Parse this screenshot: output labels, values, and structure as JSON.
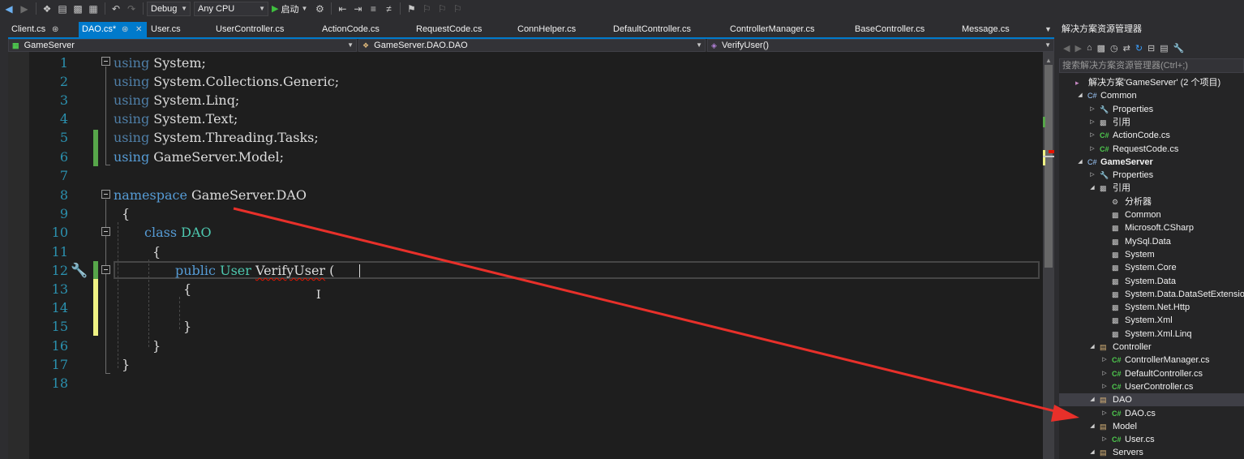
{
  "toolbar": {
    "config_combo": "Debug",
    "platform_combo": "Any CPU",
    "start_label": "启动"
  },
  "tabs": [
    {
      "label": "Client.cs",
      "active": false
    },
    {
      "label": "DAO.cs*",
      "active": true
    },
    {
      "label": "User.cs",
      "active": false
    },
    {
      "label": "UserController.cs",
      "active": false
    },
    {
      "label": "ActionCode.cs",
      "active": false
    },
    {
      "label": "RequestCode.cs",
      "active": false
    },
    {
      "label": "ConnHelper.cs",
      "active": false
    },
    {
      "label": "DefaultController.cs",
      "active": false
    },
    {
      "label": "ControllerManager.cs",
      "active": false
    },
    {
      "label": "BaseController.cs",
      "active": false
    },
    {
      "label": "Message.cs",
      "active": false
    }
  ],
  "navbar": {
    "project": "GameServer",
    "type": "GameServer.DAO.DAO",
    "member": "VerifyUser()"
  },
  "editor": {
    "line_numbers": [
      "1",
      "2",
      "3",
      "4",
      "5",
      "6",
      "7",
      "8",
      "9",
      "10",
      "11",
      "12",
      "13",
      "14",
      "15",
      "16",
      "17",
      "18"
    ],
    "lines": {
      "l1_kw": "using",
      "l1_rest": " System;",
      "l2_kw": "using",
      "l2_rest": " System.Collections.Generic;",
      "l3_kw": "using",
      "l3_rest": " System.Linq;",
      "l4_kw": "using",
      "l4_rest": " System.Text;",
      "l5_kw": "using",
      "l5_rest": " System.Threading.Tasks;",
      "l6_kw": "using",
      "l6_rest": " GameServer.Model;",
      "l8_kw": "namespace",
      "l8_rest": " GameServer.DAO",
      "l9": "{",
      "l10_kw": "class",
      "l10_type": "DAO",
      "l11": "{",
      "l12_kw": "public",
      "l12_type": "User",
      "l12_name": "VerifyUser",
      "l12_paren": " (",
      "l13": "{",
      "l15": "}",
      "l16": "}",
      "l17": "}"
    }
  },
  "solution_explorer": {
    "title": "解决方案资源管理器",
    "search_placeholder": "搜索解决方案资源管理器(Ctrl+;)",
    "tree": [
      {
        "label": "解决方案'GameServer' (2 个项目)",
        "icon": "solution-icon",
        "depth": 0,
        "expander": ""
      },
      {
        "label": "Common",
        "icon": "csproj-icon",
        "depth": 1,
        "expander": "expanded"
      },
      {
        "label": "Properties",
        "icon": "wrench-icon",
        "depth": 2,
        "expander": "collapsed"
      },
      {
        "label": "引用",
        "icon": "references-icon",
        "depth": 2,
        "expander": "collapsed"
      },
      {
        "label": "ActionCode.cs",
        "icon": "csharp-file-icon",
        "depth": 2,
        "expander": "collapsed"
      },
      {
        "label": "RequestCode.cs",
        "icon": "csharp-file-icon",
        "depth": 2,
        "expander": "collapsed"
      },
      {
        "label": "GameServer",
        "icon": "csproj-icon",
        "depth": 1,
        "expander": "expanded",
        "bold": true
      },
      {
        "label": "Properties",
        "icon": "wrench-icon",
        "depth": 2,
        "expander": "collapsed"
      },
      {
        "label": "引用",
        "icon": "references-icon",
        "depth": 2,
        "expander": "expanded"
      },
      {
        "label": "分析器",
        "icon": "analyzer-icon",
        "depth": 3,
        "expander": ""
      },
      {
        "label": "Common",
        "icon": "reference-icon",
        "depth": 3,
        "expander": ""
      },
      {
        "label": "Microsoft.CSharp",
        "icon": "reference-icon",
        "depth": 3,
        "expander": ""
      },
      {
        "label": "MySql.Data",
        "icon": "reference-icon",
        "depth": 3,
        "expander": ""
      },
      {
        "label": "System",
        "icon": "reference-icon",
        "depth": 3,
        "expander": ""
      },
      {
        "label": "System.Core",
        "icon": "reference-icon",
        "depth": 3,
        "expander": ""
      },
      {
        "label": "System.Data",
        "icon": "reference-icon",
        "depth": 3,
        "expander": ""
      },
      {
        "label": "System.Data.DataSetExtensions",
        "icon": "reference-icon",
        "depth": 3,
        "expander": ""
      },
      {
        "label": "System.Net.Http",
        "icon": "reference-icon",
        "depth": 3,
        "expander": ""
      },
      {
        "label": "System.Xml",
        "icon": "reference-icon",
        "depth": 3,
        "expander": ""
      },
      {
        "label": "System.Xml.Linq",
        "icon": "reference-icon",
        "depth": 3,
        "expander": ""
      },
      {
        "label": "Controller",
        "icon": "folder-icon",
        "depth": 2,
        "expander": "expanded"
      },
      {
        "label": "ControllerManager.cs",
        "icon": "csharp-file-icon",
        "depth": 3,
        "expander": "collapsed"
      },
      {
        "label": "DefaultController.cs",
        "icon": "csharp-file-icon",
        "depth": 3,
        "expander": "collapsed"
      },
      {
        "label": "UserController.cs",
        "icon": "csharp-file-icon",
        "depth": 3,
        "expander": "collapsed"
      },
      {
        "label": "DAO",
        "icon": "folder-icon",
        "depth": 2,
        "expander": "expanded",
        "selected": true
      },
      {
        "label": "DAO.cs",
        "icon": "csharp-file-icon",
        "depth": 3,
        "expander": "collapsed"
      },
      {
        "label": "Model",
        "icon": "folder-icon",
        "depth": 2,
        "expander": "expanded"
      },
      {
        "label": "User.cs",
        "icon": "csharp-file-icon",
        "depth": 3,
        "expander": "collapsed"
      },
      {
        "label": "Servers",
        "icon": "folder-icon",
        "depth": 2,
        "expander": "expanded"
      }
    ]
  },
  "colors": {
    "accent": "#007acc",
    "annotation_arrow": "#e8302a",
    "keyword": "#569cd6",
    "type": "#4ec9b0",
    "line_number": "#2b91af"
  }
}
